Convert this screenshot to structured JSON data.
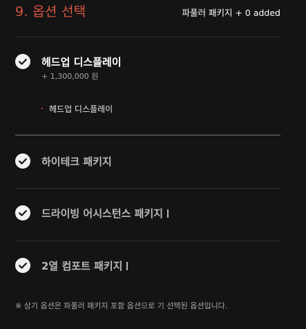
{
  "header": {
    "title": "9. 옵션 선택",
    "added_summary": "파풀러 패키지 + 0 added"
  },
  "options": [
    {
      "label": "헤드업 디스플레이",
      "price": "+ 1,300,000 원",
      "selected": true,
      "details": [
        "헤드업 디스플레이"
      ]
    },
    {
      "label": "하이테크 패키지",
      "selected": true
    },
    {
      "label": "드라이빙 어시스턴스 패키지",
      "selected": true,
      "has_info": true
    },
    {
      "label": "2열 컴포트 패키지",
      "selected": true,
      "has_info": true
    }
  ],
  "footnote": "※ 상기 옵션은 파풀러 패키지 포함 옵션으로 기 선택된 옵션입니다.",
  "colors": {
    "accent": "#d8563f",
    "background": "#141414",
    "check_fill": "#f2f2f2",
    "check_mark": "#141414"
  },
  "icons": {
    "check": "check-circle-icon",
    "info": "info-icon"
  }
}
